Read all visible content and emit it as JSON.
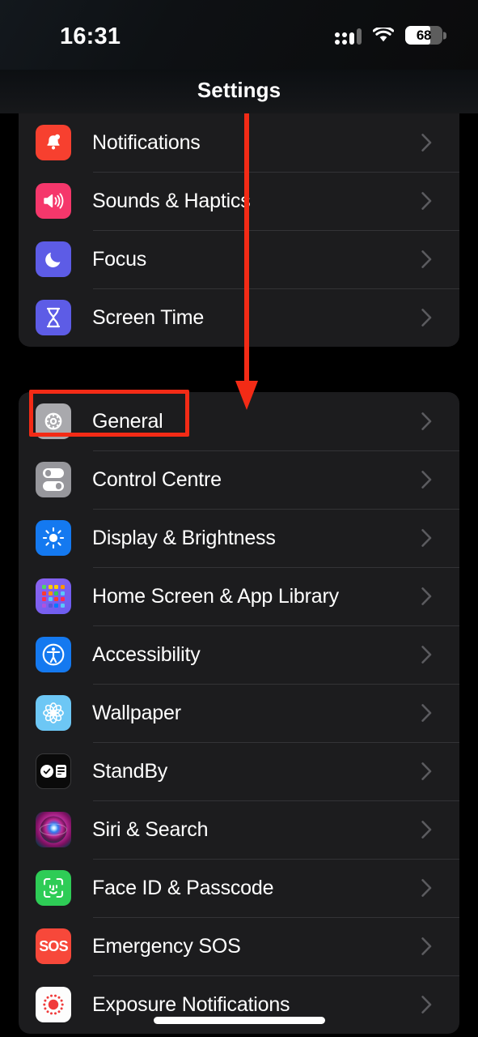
{
  "status_bar": {
    "time": "16:31",
    "cellular_icon": "cellular-dots-icon",
    "wifi_icon": "wifi-icon",
    "battery_percent": "68",
    "battery_icon": "battery-icon"
  },
  "nav": {
    "title": "Settings"
  },
  "sections": [
    {
      "id": "section-alerts",
      "clipped_top": true,
      "rows": [
        {
          "label": "Notifications",
          "icon": "bell-icon",
          "icon_class": "ic-notifications",
          "chevron": "chevron-right-icon"
        },
        {
          "label": "Sounds & Haptics",
          "icon": "speaker-waves-icon",
          "icon_class": "ic-sounds",
          "chevron": "chevron-right-icon"
        },
        {
          "label": "Focus",
          "icon": "moon-icon",
          "icon_class": "ic-focus",
          "chevron": "chevron-right-icon"
        },
        {
          "label": "Screen Time",
          "icon": "hourglass-icon",
          "icon_class": "ic-screentime",
          "chevron": "chevron-right-icon"
        }
      ]
    },
    {
      "id": "section-system",
      "clipped_top": false,
      "rows": [
        {
          "label": "General",
          "icon": "gear-icon",
          "icon_class": "ic-general",
          "chevron": "chevron-right-icon",
          "highlighted": true
        },
        {
          "label": "Control Centre",
          "icon": "toggles-icon",
          "icon_class": "ic-control",
          "chevron": "chevron-right-icon"
        },
        {
          "label": "Display & Brightness",
          "icon": "sun-icon",
          "icon_class": "ic-display",
          "chevron": "chevron-right-icon"
        },
        {
          "label": "Home Screen & App Library",
          "icon": "app-grid-icon",
          "icon_class": "ic-home",
          "chevron": "chevron-right-icon"
        },
        {
          "label": "Accessibility",
          "icon": "accessibility-icon",
          "icon_class": "ic-access",
          "chevron": "chevron-right-icon"
        },
        {
          "label": "Wallpaper",
          "icon": "flower-icon",
          "icon_class": "ic-wallpaper",
          "chevron": "chevron-right-icon"
        },
        {
          "label": "StandBy",
          "icon": "standby-icon",
          "icon_class": "ic-standby",
          "chevron": "chevron-right-icon"
        },
        {
          "label": "Siri & Search",
          "icon": "siri-orb-icon",
          "icon_class": "ic-siri",
          "chevron": "chevron-right-icon"
        },
        {
          "label": "Face ID & Passcode",
          "icon": "face-id-icon",
          "icon_class": "ic-faceid",
          "chevron": "chevron-right-icon"
        },
        {
          "label": "Emergency SOS",
          "icon": "sos-icon",
          "icon_class": "ic-sos",
          "chevron": "chevron-right-icon",
          "icon_text": "SOS"
        },
        {
          "label": "Exposure Notifications",
          "icon": "exposure-icon",
          "icon_class": "ic-exposure",
          "chevron": "chevron-right-icon"
        }
      ]
    }
  ],
  "annotation": {
    "highlight_target": "General",
    "highlight_color": "#f32b16",
    "arrow_color": "#f32b16",
    "arrow_direction": "down",
    "arrow_points_to": "General"
  },
  "home_indicator": "home-indicator"
}
